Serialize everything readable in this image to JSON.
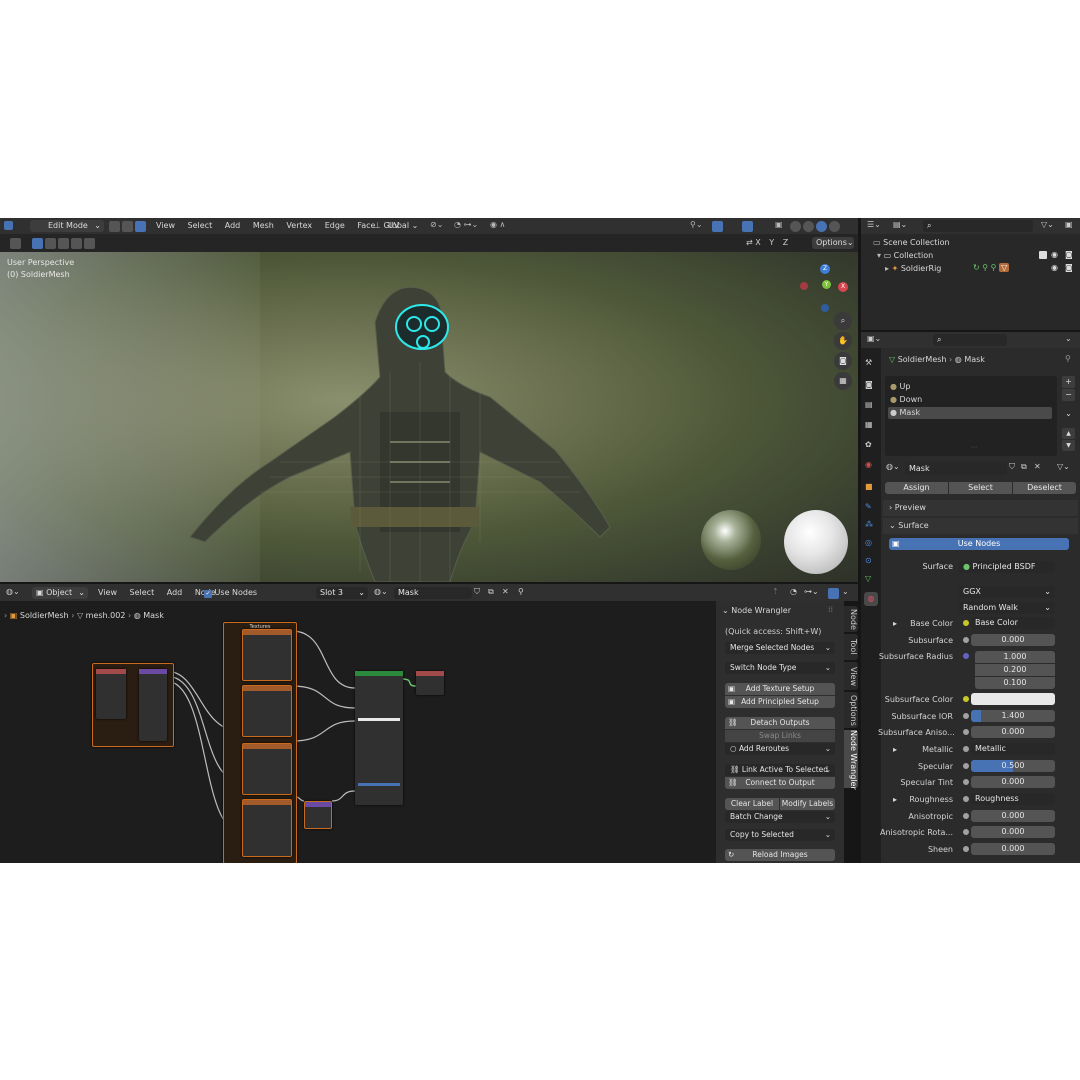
{
  "viewport_header": {
    "mode": "Edit Mode",
    "menus": [
      "View",
      "Select",
      "Add",
      "Mesh",
      "Vertex",
      "Edge",
      "Face",
      "UV"
    ],
    "orientation": "Global",
    "options": "Options",
    "axes": [
      "X",
      "Y",
      "Z"
    ]
  },
  "viewport": {
    "perspective": "User Perspective",
    "object": "(0) SoldierMesh",
    "gizmo_axes": [
      "X",
      "Y",
      "Z"
    ]
  },
  "outliner": {
    "scene_collection": "Scene Collection",
    "collection": "Collection",
    "rig": "SoldierRig"
  },
  "properties": {
    "breadcrumb_object": "SoldierMesh",
    "breadcrumb_material": "Mask",
    "slots": [
      "Up",
      "Down",
      "Mask"
    ],
    "material_name": "Mask",
    "assign": "Assign",
    "select": "Select",
    "deselect": "Deselect",
    "preview": "Preview",
    "surface_panel": "Surface",
    "use_nodes": "Use Nodes",
    "surface_label": "Surface",
    "surface_shader": "Principled BSDF",
    "distribution": "GGX",
    "subsurface_method": "Random Walk",
    "rows": [
      {
        "label": "Base Color",
        "value": "Base Color"
      },
      {
        "label": "Subsurface",
        "value": "0.000"
      },
      {
        "label": "Subsurface Radius",
        "value": "1.000"
      },
      {
        "label": "",
        "value": "0.200"
      },
      {
        "label": "",
        "value": "0.100"
      },
      {
        "label": "Subsurface Color",
        "value": ""
      },
      {
        "label": "Subsurface IOR",
        "value": "1.400"
      },
      {
        "label": "Subsurface Aniso...",
        "value": "0.000"
      },
      {
        "label": "Metallic",
        "value": "Metallic"
      },
      {
        "label": "Specular",
        "value": "0.500"
      },
      {
        "label": "Specular Tint",
        "value": "0.000"
      },
      {
        "label": "Roughness",
        "value": "Roughness"
      },
      {
        "label": "Anisotropic",
        "value": "0.000"
      },
      {
        "label": "Anisotropic Rota...",
        "value": "0.000"
      },
      {
        "label": "Sheen",
        "value": "0.000"
      }
    ]
  },
  "node_header": {
    "object_mode": "Object",
    "menus": [
      "View",
      "Select",
      "Add",
      "Node"
    ],
    "use_nodes": "Use Nodes",
    "slot": "Slot 3",
    "material": "Mask"
  },
  "node_breadcrumb": {
    "object": "SoldierMesh",
    "mesh": "mesh.002",
    "material": "Mask"
  },
  "node_frame": {
    "textures": "Textures"
  },
  "node_wrangler": {
    "title": "Node Wrangler",
    "quick_access": "(Quick access: Shift+W)",
    "merge": "Merge Selected Nodes",
    "switch": "Switch Node Type",
    "add_texture": "Add Texture Setup",
    "add_principled": "Add Principled Setup",
    "detach": "Detach Outputs",
    "swap": "Swap Links",
    "add_reroutes": "Add Reroutes",
    "link_active": "Link Active To Selected",
    "connect_output": "Connect to Output",
    "clear_label": "Clear Label",
    "modify_labels": "Modify Labels",
    "batch_change": "Batch Change",
    "copy_selected": "Copy to Selected",
    "reload_images": "Reload Images"
  },
  "node_tabs": [
    "Node",
    "Tool",
    "View",
    "Options",
    "Node Wrangler"
  ]
}
